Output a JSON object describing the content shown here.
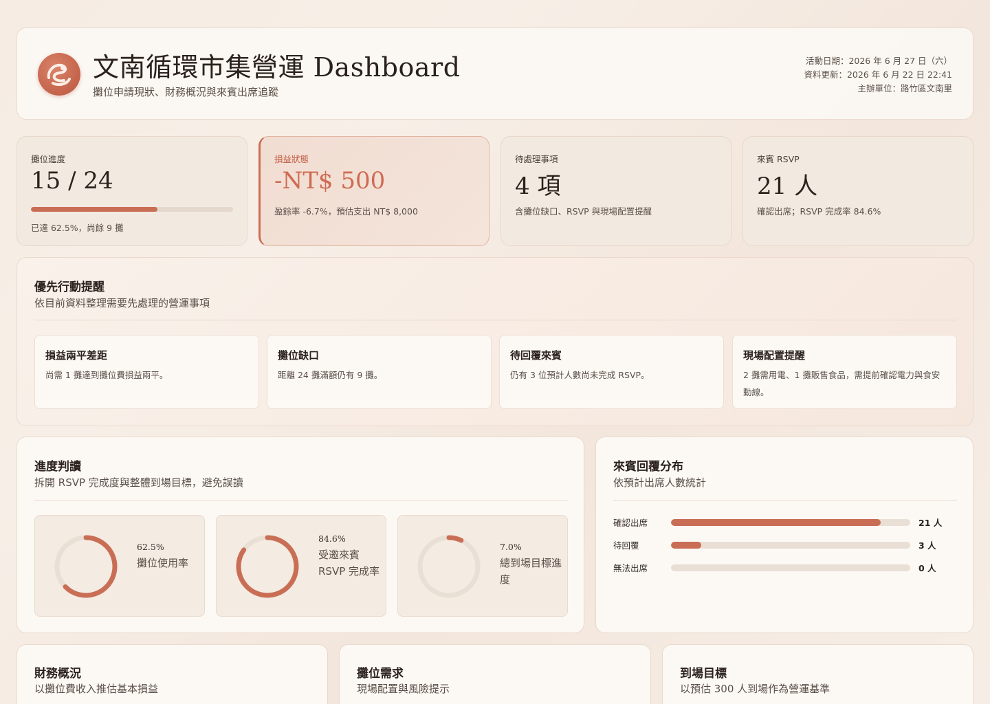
{
  "header": {
    "title": "文南循環市集營運 Dashboard",
    "subtitle": "攤位申請現狀、財務概況與來賓出席追蹤",
    "event_date": "活動日期：2026 年 6 月 27 日（六）",
    "updated": "資料更新：2026 年 6 月 22 日 22:41",
    "organizer": "主辦單位：路竹區文南里"
  },
  "kpis": {
    "booth": {
      "label": "攤位進度",
      "value": "15 / 24",
      "progress": 0.625,
      "note": "已達 62.5%，尚餘 9 攤"
    },
    "pnl": {
      "label": "損益狀態",
      "value": "-NT$ 500",
      "note": "盈餘率 -6.7%，預估支出 NT$ 8,000"
    },
    "todo": {
      "label": "待處理事項",
      "value": "4 項",
      "note": "含攤位缺口、RSVP 與現場配置提醒"
    },
    "rsvp": {
      "label": "來賓 RSVP",
      "value": "21 人",
      "note": "確認出席；RSVP 完成率 84.6%"
    }
  },
  "priority": {
    "title": "優先行動提醒",
    "subtitle": "依目前資料整理需要先處理的營運事項",
    "alerts": [
      {
        "title": "損益兩平差距",
        "text": "尚需 1 攤達到攤位費損益兩平。"
      },
      {
        "title": "攤位缺口",
        "text": "距離 24 攤滿額仍有 9 攤。"
      },
      {
        "title": "待回覆來賓",
        "text": "仍有 3 位預計人數尚未完成 RSVP。"
      },
      {
        "title": "現場配置提醒",
        "text": "2 攤需用電、1 攤販售食品，需提前確認電力與食安動線。"
      }
    ]
  },
  "progress": {
    "title": "進度判讀",
    "subtitle": "拆開 RSVP 完成度與整體到場目標，避免誤讀",
    "donuts": [
      {
        "pct": "62.5%",
        "value": 0.625,
        "label": "攤位使用率"
      },
      {
        "pct": "84.6%",
        "value": 0.846,
        "label": "受邀來賓 RSVP 完成率"
      },
      {
        "pct": "7.0%",
        "value": 0.07,
        "label": "總到場目標進度"
      }
    ]
  },
  "guests": {
    "title": "來賓回覆分布",
    "subtitle": "依預計出席人數統計",
    "rows": [
      {
        "label": "確認出席",
        "value": "21 人",
        "fraction": 0.875
      },
      {
        "label": "待回覆",
        "value": "3 人",
        "fraction": 0.125
      },
      {
        "label": "無法出席",
        "value": "0 人",
        "fraction": 0
      }
    ]
  },
  "bottom": [
    {
      "title": "財務概況",
      "subtitle": "以攤位費收入推估基本損益"
    },
    {
      "title": "攤位需求",
      "subtitle": "現場配置與風險提示"
    },
    {
      "title": "到場目標",
      "subtitle": "以預估 300 人到場作為營運基準"
    }
  ],
  "colors": {
    "accent": "#c96e55",
    "track": "#e9dfd5",
    "background": "#f6ece3"
  }
}
